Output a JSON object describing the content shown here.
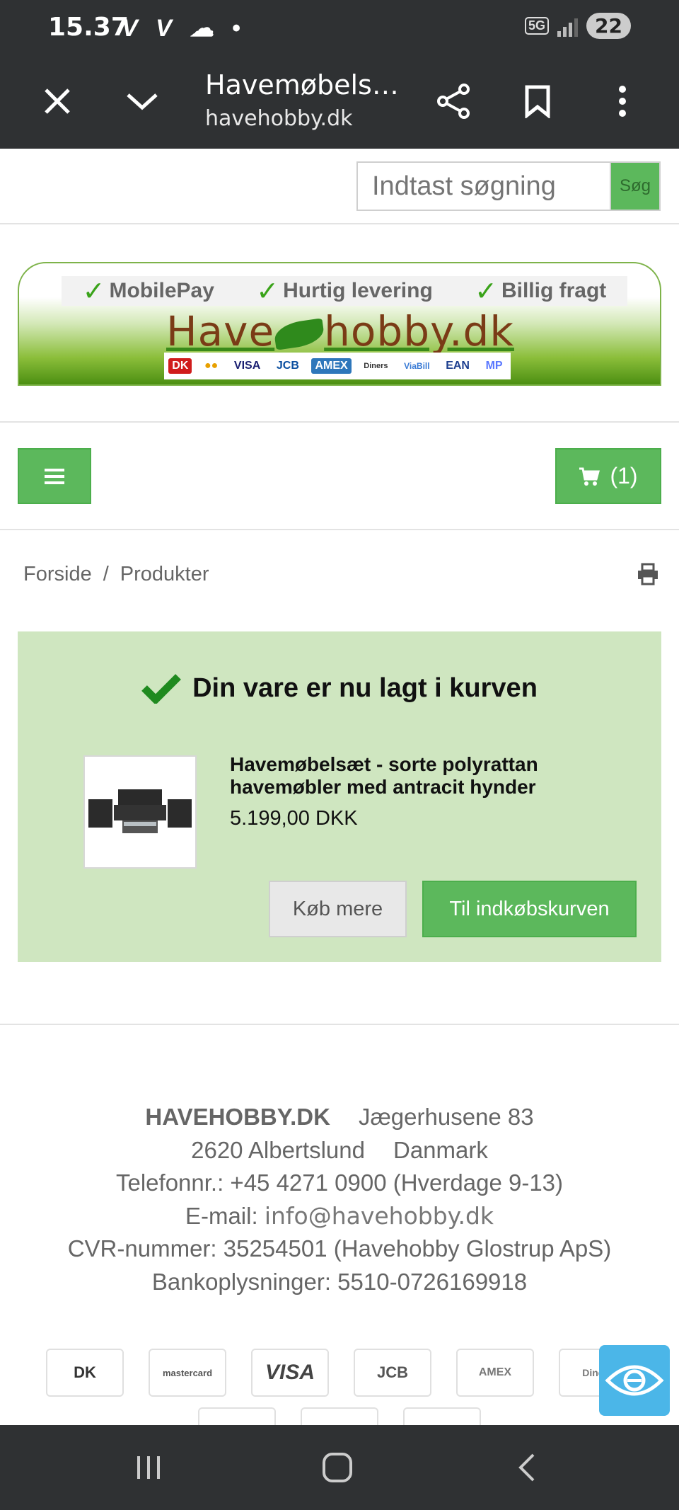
{
  "status": {
    "time": "15.37",
    "left_icons": "V V ☁ •",
    "network": "5G",
    "battery": "22"
  },
  "browser": {
    "title": "Havemøbels…",
    "url": "havehobby.dk",
    "icons": [
      "close-icon",
      "chevron-down-icon",
      "share-icon",
      "bookmark-icon",
      "more-vert-icon"
    ]
  },
  "search": {
    "placeholder": "Indtast søgning",
    "button": "Søg"
  },
  "banner": {
    "usps": [
      "MobilePay",
      "Hurtig levering",
      "Billig fragt"
    ],
    "brand_left": "Have",
    "brand_right": "hobby.dk",
    "cards": [
      "DK",
      "●●",
      "VISA",
      "JCB",
      "AMEX",
      "Diners",
      "ViaBill",
      "EAN",
      "MP"
    ]
  },
  "header": {
    "cart_count": "(1)"
  },
  "breadcrumb": {
    "home": "Forside",
    "separator": "/",
    "current": "Produkter"
  },
  "added": {
    "message": "Din vare er nu lagt i kurven",
    "product_name": "Havemøbelsæt - sorte polyrattan havemøbler med antracit hynder",
    "price": "5.199,00 DKK",
    "buy_more": "Køb mere",
    "to_cart": "Til indkøbskurven"
  },
  "footer": {
    "company": "HAVEHOBBY.DK",
    "street": "Jægerhusene 83",
    "city": "2620 Albertslund",
    "country": "Danmark",
    "phone": "Telefonnr.: +45 4271 0900 (Hverdage 9-13)",
    "email_label": "E-mail:",
    "email": "info@havehobby.dk",
    "cvr": "CVR-nummer: 35254501 (Havehobby Glostrup ApS)",
    "bank": "Bankoplysninger: 5510-0726169918",
    "payment_icons": [
      "DK",
      "mastercard",
      "VISA",
      "JCB",
      "AMEX",
      "Diners"
    ]
  },
  "colors": {
    "green": "#5cb85c",
    "panel": "#cfe6c0",
    "dark": "#2f3133",
    "a11y": "#4bb6e8"
  }
}
